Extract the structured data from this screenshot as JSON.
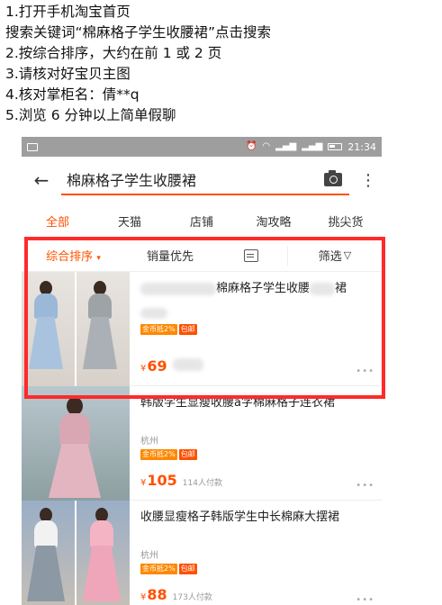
{
  "instructions": [
    "1.打开手机淘宝首页",
    "搜索关键词“棉麻格子学生收腰裙”点击搜索",
    "2.按综合排序，大约在前 1 或 2 页",
    "3.请核对好宝贝主图",
    "4.核对掌柜名：倩**q",
    "5.浏览 6 分钟以上简单假聊"
  ],
  "statusbar": {
    "time": "21:34"
  },
  "search": {
    "query": "棉麻格子学生收腰裙"
  },
  "tabs": [
    "全部",
    "天猫",
    "店铺",
    "淘攻略",
    "挑尖货"
  ],
  "sort": {
    "default_label": "综合排序",
    "sales_label": "销量优先",
    "filter_label": "筛选"
  },
  "products": [
    {
      "title": "棉麻格子学生收腰",
      "title_suffix": "裙",
      "location": "",
      "badges": [
        "金币抵2%",
        "包邮"
      ],
      "price": "69",
      "paid": ""
    },
    {
      "title": "韩版学生显瘦收腰a字棉麻格子连衣裙",
      "location": "杭州",
      "badges": [
        "金币抵2%",
        "包邮"
      ],
      "price": "105",
      "paid": "114人付款"
    },
    {
      "title": "收腰显瘦格子韩版学生中长棉麻大摆裙",
      "location": "杭州",
      "badges": [
        "金币抵2%",
        "包邮"
      ],
      "price": "88",
      "paid": "173人付款"
    }
  ],
  "colors": {
    "accent": "#ff5000",
    "highlight_box": "#ff2a2a",
    "statusbar": "#9e9e9e"
  },
  "icons": [
    "back-arrow-icon",
    "camera-icon",
    "more-vertical-icon",
    "caret-down-icon",
    "list-view-icon",
    "filter-icon",
    "wifi-icon",
    "signal-icon",
    "battery-icon",
    "image-notification-icon",
    "alarm-icon"
  ]
}
